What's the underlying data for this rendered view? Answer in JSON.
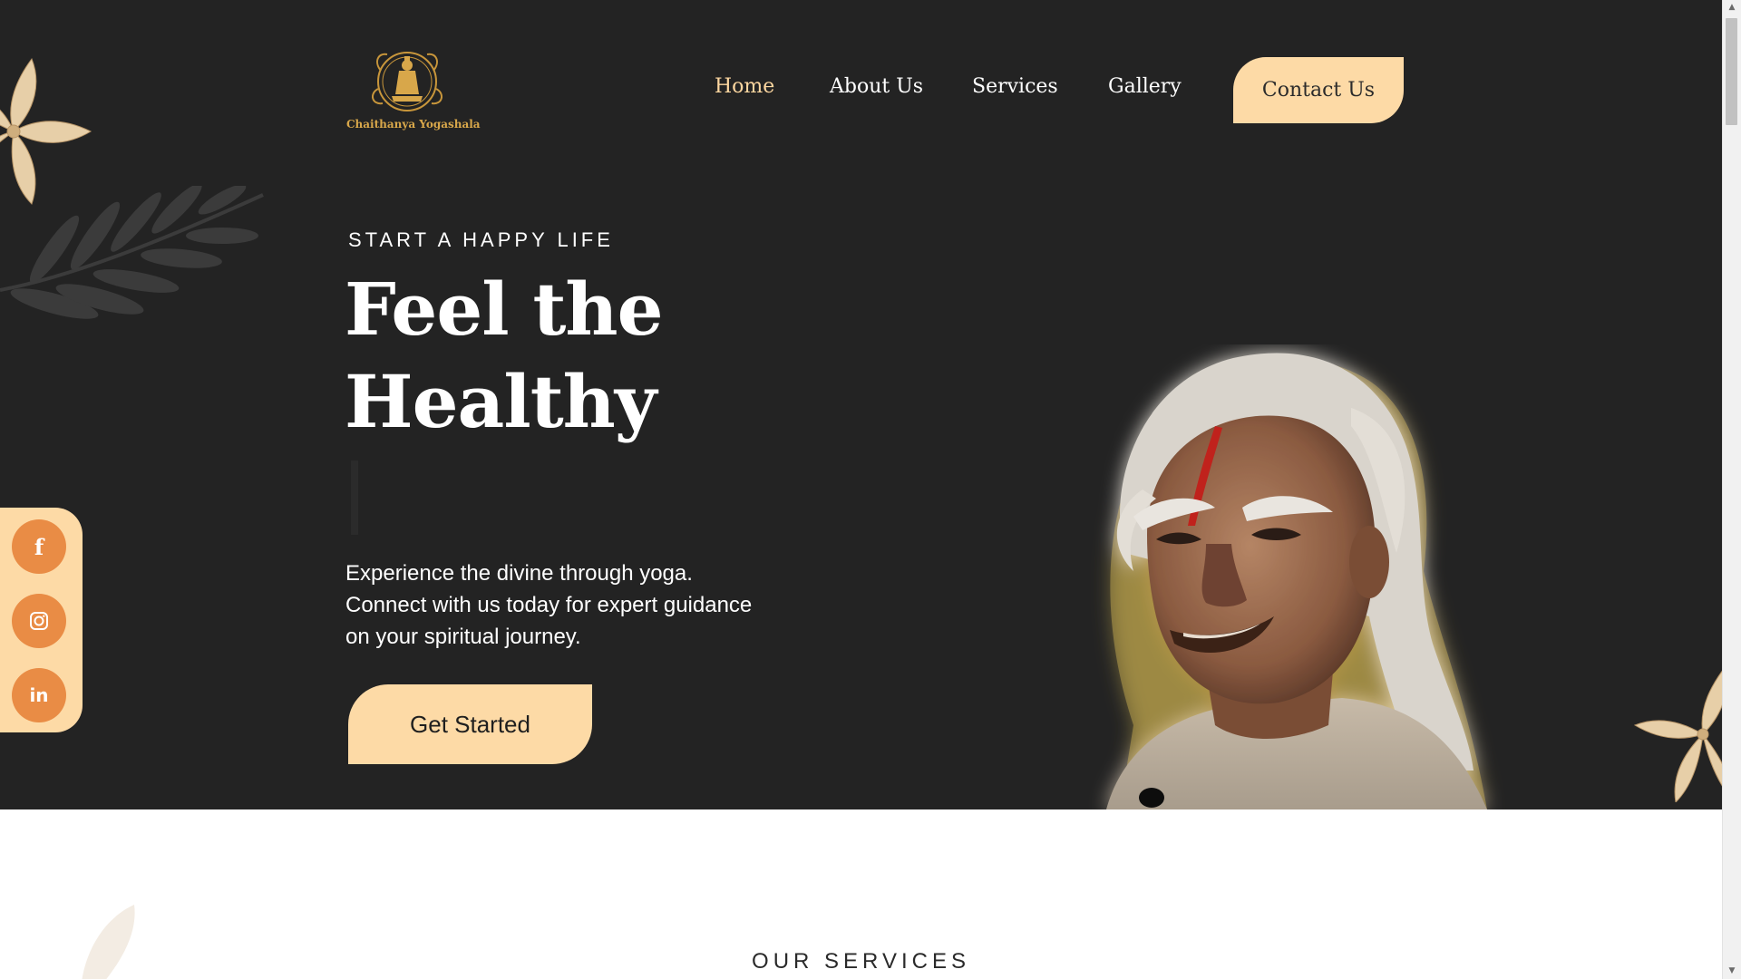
{
  "brand": {
    "name": "Chaithanya Yogashala"
  },
  "nav": {
    "items": [
      {
        "label": "Home",
        "active": true
      },
      {
        "label": "About Us",
        "active": false
      },
      {
        "label": "Services",
        "active": false
      },
      {
        "label": "Gallery",
        "active": false
      }
    ],
    "cta_label": "Contact Us"
  },
  "hero": {
    "eyebrow": "START A HAPPY LIFE",
    "headline_line1": "Feel the",
    "headline_line2": "Healthy",
    "description": "Experience the divine through yoga. Connect with us today for expert guidance on your spiritual journey.",
    "cta_label": "Get Started"
  },
  "social": [
    {
      "icon": "facebook-icon",
      "glyph": "f"
    },
    {
      "icon": "instagram-icon",
      "glyph": ""
    },
    {
      "icon": "linkedin-icon",
      "glyph": "in"
    }
  ],
  "services": {
    "title": "OUR SERVICES"
  },
  "colors": {
    "hero_bg": "#232323",
    "accent": "#fddaa6",
    "active_nav": "#fdd7a0",
    "social_button": "#e98c45",
    "logo_gold": "#d8a74a"
  }
}
